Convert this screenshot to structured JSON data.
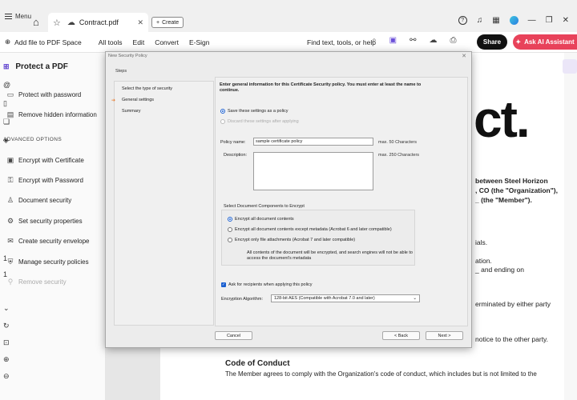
{
  "titlebar": {
    "menu_label": "Menu",
    "tab_name": "Contract.pdf",
    "create_label": "Create"
  },
  "toolbar": {
    "add_file_label": "Add file to PDF Space",
    "nav": [
      "All tools",
      "Edit",
      "Convert",
      "E-Sign"
    ],
    "find_label": "Find text, tools, or help",
    "share_label": "Share",
    "ai_label": "Ask AI Assistant"
  },
  "left_panel": {
    "title": "Protect a PDF",
    "items_top": [
      {
        "label": "Protect with password",
        "icon": "password-icon"
      },
      {
        "label": "Remove hidden information",
        "icon": "document-icon"
      }
    ],
    "section_label": "ADVANCED OPTIONS",
    "items_adv": [
      {
        "label": "Encrypt with Certificate",
        "icon": "certificate-icon"
      },
      {
        "label": "Encrypt with Password",
        "icon": "key-icon"
      },
      {
        "label": "Document security",
        "icon": "user-lock-icon"
      },
      {
        "label": "Set security properties",
        "icon": "gear-icon"
      },
      {
        "label": "Create security envelope",
        "icon": "envelope-icon"
      },
      {
        "label": "Manage security policies",
        "icon": "policy-icon"
      },
      {
        "label": "Remove security",
        "icon": "unlock-icon"
      }
    ]
  },
  "document": {
    "big_text": "ct.",
    "lines": [
      "between Steel Horizon",
      ", CO (the \"Organization\"),",
      "_ (the \"Member\").",
      "ials.",
      "ation.",
      "_ and ending on",
      "erminated by either party",
      "notice to the other party."
    ],
    "heading": "Code of Conduct",
    "paragraph": "The Member agrees to comply with the Organization's code of conduct, which includes but is not limited to the"
  },
  "dialog": {
    "title": "New Security Policy",
    "steps_label": "Steps",
    "steps": [
      "Select the type of security",
      "General settings",
      "Summary"
    ],
    "intro": "Enter general information for this Certificate Security policy. You must enter at least the name to continue.",
    "radio_save": "Save these settings as a policy",
    "radio_discard": "Discard these settings after applying",
    "policy_name_label": "Policy name:",
    "policy_name_value": "sample certificate policy",
    "policy_name_hint": "max. 50 Characters",
    "description_label": "Description:",
    "description_value": "",
    "description_hint": "max. 250 Characters",
    "components_title": "Select Document Components to Encrypt",
    "components": [
      "Encrypt all document contents",
      "Encrypt all document contents except metadata (Acrobat 6 and later compatible)",
      "Encrypt only file attachments (Acrobat 7 and later compatible)"
    ],
    "components_note": "All contents of the document will be encrypted, and search engines will not be able to access the document's metadata",
    "ask_recipients_label": "Ask for recipients when applying this policy",
    "algorithm_label": "Encryption Algorithm:",
    "algorithm_value": "128-bit AES (Compatible with Acrobat 7.0 and later)",
    "cancel_label": "Cancel",
    "back_label": "< Back",
    "next_label": "Next >"
  }
}
